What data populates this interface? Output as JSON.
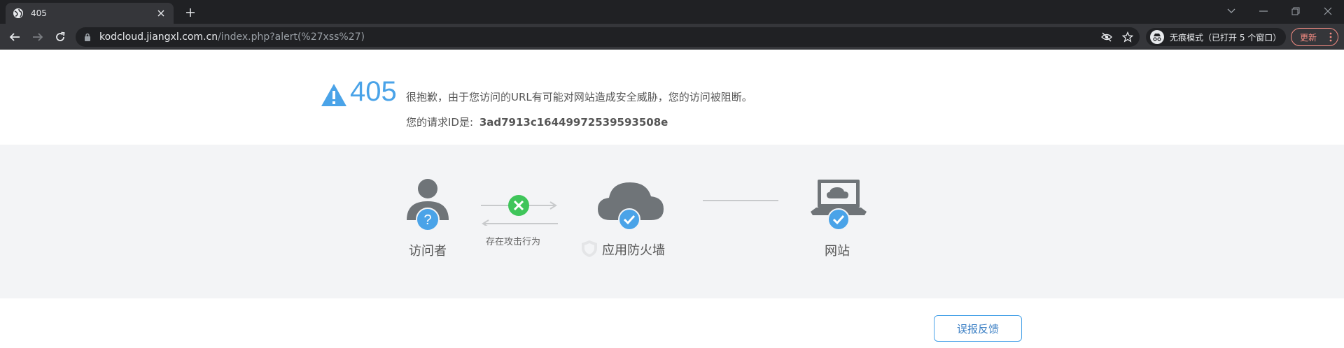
{
  "browser": {
    "tab_title": "405",
    "url_host": "kodcloud.jiangxl.com.cn",
    "url_path": "/index.php?alert(%27xss%27)",
    "incognito_label": "无痕模式（已打开 5 个窗口）",
    "update_label": "更新"
  },
  "error": {
    "code": "405",
    "message": "很抱歉，由于您访问的URL有可能对网站造成安全威胁，您的访问被阻断。",
    "request_id_label": "您的请求ID是:",
    "request_id": "3ad7913c16449972539593508e"
  },
  "flow": {
    "visitor_label": "访问者",
    "attack_label": "存在攻击行为",
    "firewall_label": "应用防火墙",
    "website_label": "网站"
  },
  "feedback_label": "误报反馈",
  "colors": {
    "accent_blue": "#4aa3e8",
    "green": "#3fc55a",
    "gray_icon": "#6f7478",
    "band_bg": "#f3f4f6"
  }
}
